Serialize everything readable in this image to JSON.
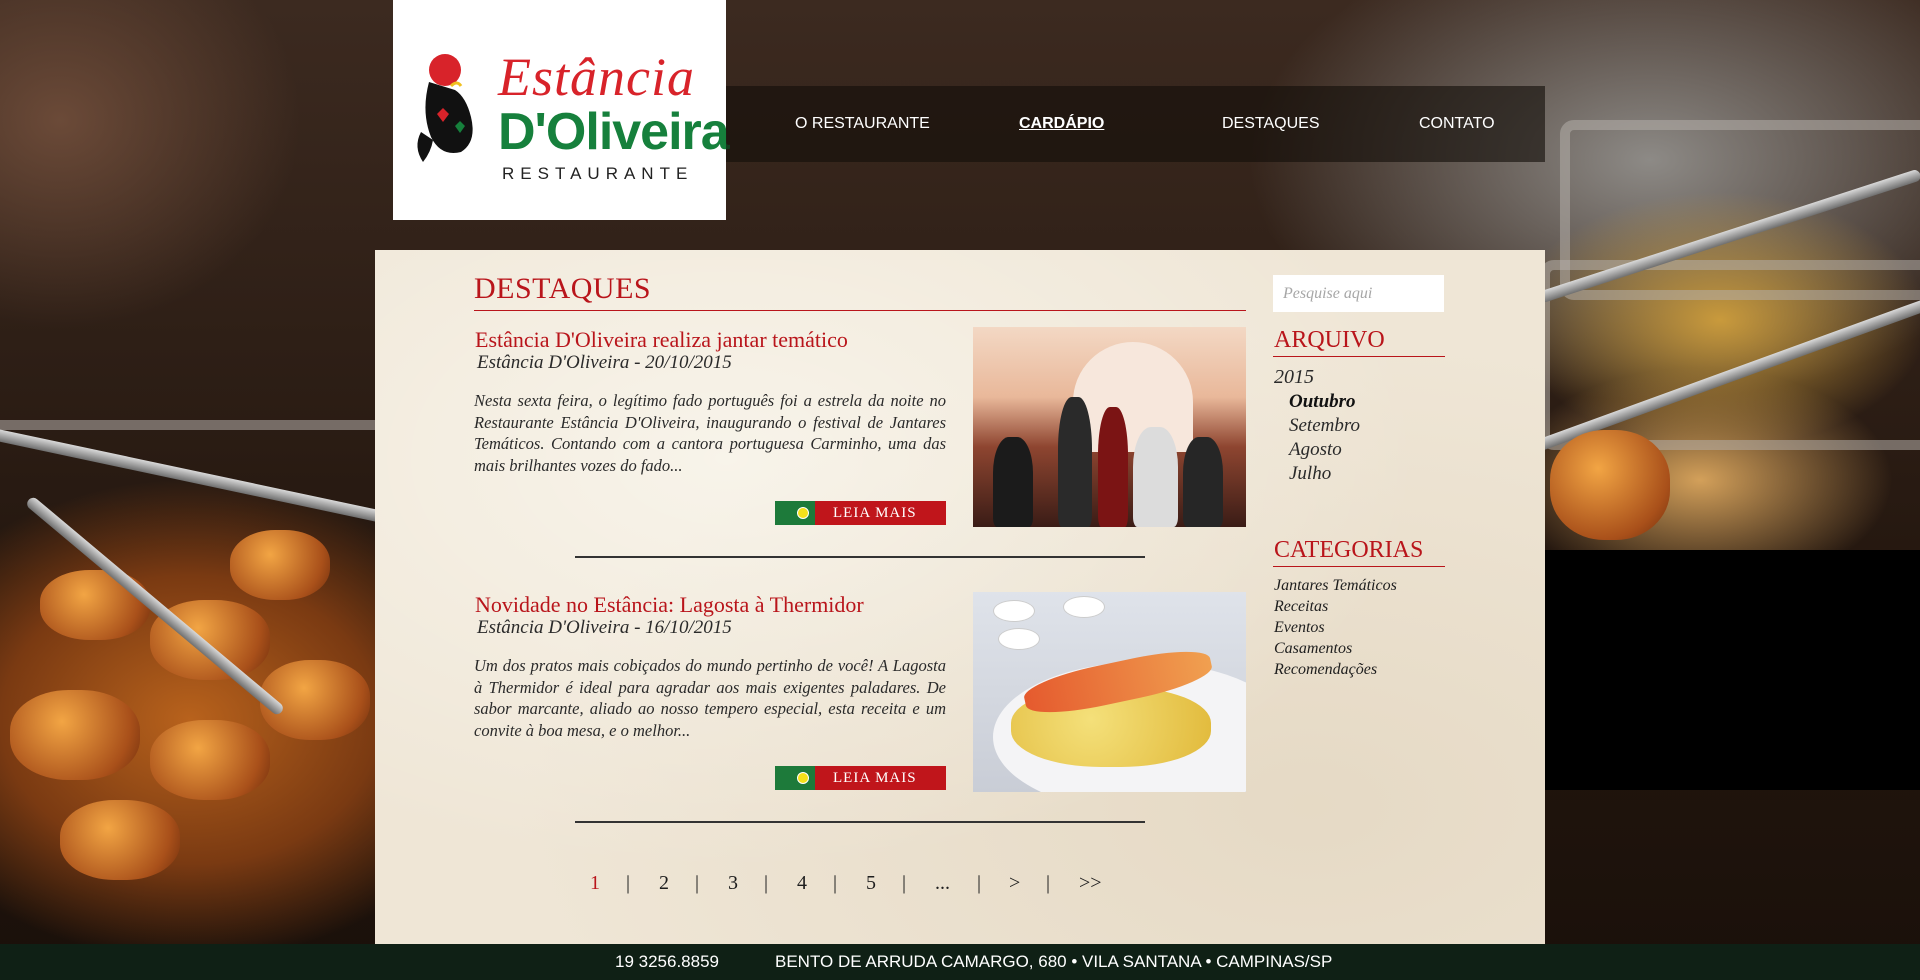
{
  "logo": {
    "line1": "Estância",
    "line2": "D'Oliveira",
    "line3": "RESTAURANTE"
  },
  "nav": {
    "items": [
      {
        "label": "O RESTAURANTE",
        "active": false
      },
      {
        "label": "CARDÁPIO",
        "active": true
      },
      {
        "label": "DESTAQUES",
        "active": false
      },
      {
        "label": "CONTATO",
        "active": false
      }
    ]
  },
  "main": {
    "title": "DESTAQUES",
    "posts": [
      {
        "title": "Estância D'Oliveira realiza jantar temático",
        "meta": "Estância D'Oliveira - 20/10/2015",
        "excerpt": "Nesta sexta feira, o legítimo fado português foi a estrela da noite no Restaurante Estância D'Oliveira, inaugurando o festival de Jantares Temáticos. Contando com a cantora portuguesa Carminho, uma das mais brilhantes vozes do fado...",
        "read_more": "LEIA MAIS"
      },
      {
        "title": "Novidade no Estância: Lagosta à Thermidor",
        "meta": "Estância D'Oliveira - 16/10/2015",
        "excerpt": "Um dos pratos mais cobiçados do mundo pertinho de você! A Lagosta à Thermidor é ideal para agradar aos mais exigentes paladares. De sabor marcante, aliado ao nosso tempero especial, esta receita e um convite à boa mesa, e o melhor...",
        "read_more": "LEIA MAIS"
      }
    ]
  },
  "pagination": {
    "current": "1",
    "items": [
      "1",
      "2",
      "3",
      "4",
      "5",
      "...",
      ">",
      ">>"
    ],
    "separator": "|"
  },
  "sidebar": {
    "search_placeholder": "Pesquise aqui",
    "archive_title": "ARQUIVO",
    "archive_year": "2015",
    "archive_months": [
      {
        "label": "Outubro",
        "active": true
      },
      {
        "label": "Setembro",
        "active": false
      },
      {
        "label": "Agosto",
        "active": false
      },
      {
        "label": "Julho",
        "active": false
      }
    ],
    "categories_title": "CATEGORIAS",
    "categories": [
      "Jantares Temáticos",
      "Receitas",
      "Eventos",
      "Casamentos",
      "Recomendações"
    ]
  },
  "footer": {
    "phone": "19  3256.8859",
    "address": "BENTO DE ARRUDA CAMARGO, 680 • VILA SANTANA • CAMPINAS/SP"
  },
  "colors": {
    "brand_red": "#b9151b",
    "brand_green": "#16803c",
    "footer_bg": "#0f2015",
    "panel_bg": "#efe6d6"
  }
}
